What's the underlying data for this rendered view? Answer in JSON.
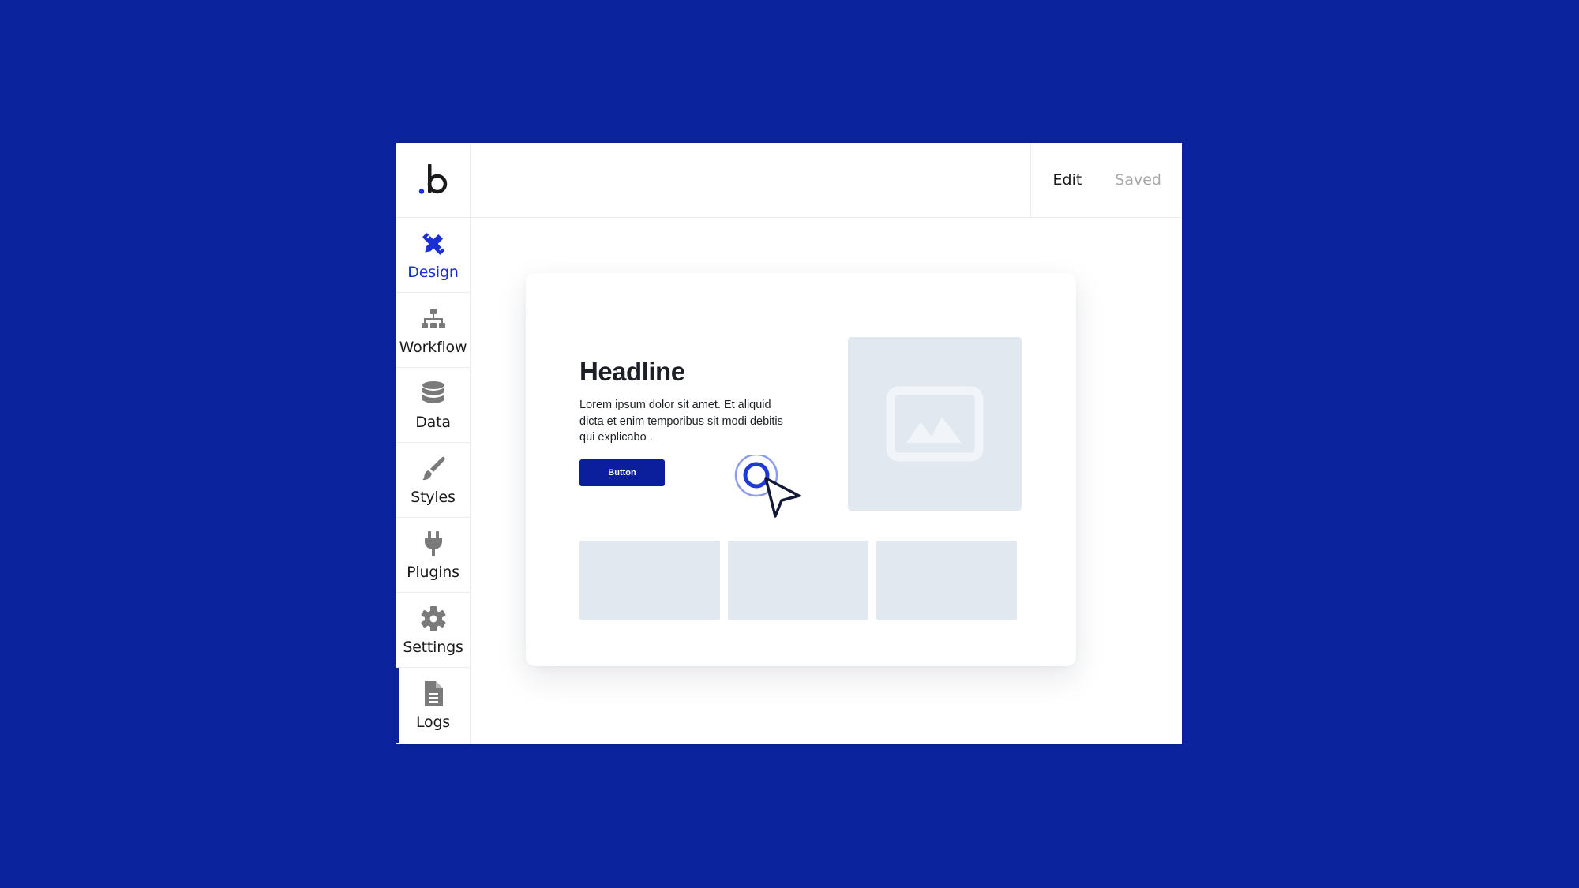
{
  "app": {
    "logo_text": "b",
    "brand_color": "#0b249e",
    "accent_color": "#1a2fd6"
  },
  "sidebar": {
    "items": [
      {
        "label": "Design",
        "icon": "design-icon",
        "active": true
      },
      {
        "label": "Workflow",
        "icon": "workflow-icon",
        "active": false
      },
      {
        "label": "Data",
        "icon": "database-icon",
        "active": false
      },
      {
        "label": "Styles",
        "icon": "brush-icon",
        "active": false
      },
      {
        "label": "Plugins",
        "icon": "plug-icon",
        "active": false
      },
      {
        "label": "Settings",
        "icon": "gear-icon",
        "active": false
      },
      {
        "label": "Logs",
        "icon": "document-icon",
        "active": false
      }
    ]
  },
  "header": {
    "edit_label": "Edit",
    "saved_label": "Saved"
  },
  "canvas": {
    "card": {
      "headline": "Headline",
      "body": "Lorem ipsum dolor sit amet. Et aliquid dicta et enim temporibus sit modi debitis qui explicabo .",
      "button_label": "Button",
      "image_placeholder_icon": "image-icon"
    }
  }
}
